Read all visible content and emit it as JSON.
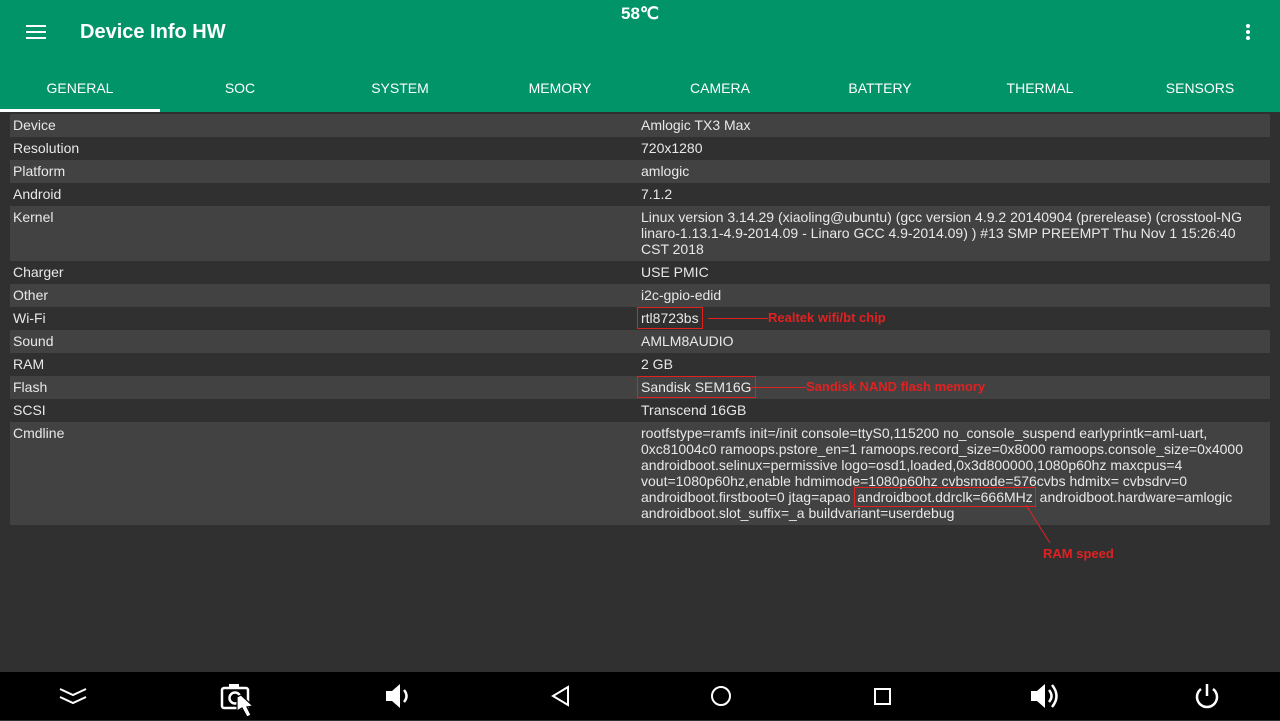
{
  "status": {
    "temperature": "58℃"
  },
  "app": {
    "title": "Device Info HW"
  },
  "tabs": [
    "GENERAL",
    "SOC",
    "SYSTEM",
    "MEMORY",
    "CAMERA",
    "BATTERY",
    "THERMAL",
    "SENSORS"
  ],
  "active_tab": "GENERAL",
  "rows": [
    {
      "key": "Device",
      "value": "Amlogic TX3 Max"
    },
    {
      "key": "Resolution",
      "value": "720x1280"
    },
    {
      "key": "Platform",
      "value": "amlogic"
    },
    {
      "key": "Android",
      "value": "7.1.2"
    },
    {
      "key": "Kernel",
      "value": "Linux version 3.14.29 (xiaoling@ubuntu) (gcc version 4.9.2 20140904 (prerelease) (crosstool-NG linaro-1.13.1-4.9-2014.09 - Linaro GCC 4.9-2014.09) ) #13 SMP PREEMPT Thu Nov 1 15:26:40 CST 2018"
    },
    {
      "key": "Charger",
      "value": "USE PMIC"
    },
    {
      "key": "Other",
      "value": "i2c-gpio-edid"
    },
    {
      "key": "Wi-Fi",
      "value": "rtl8723bs"
    },
    {
      "key": "Sound",
      "value": "AMLM8AUDIO"
    },
    {
      "key": "RAM",
      "value": "2 GB"
    },
    {
      "key": "Flash",
      "value": "Sandisk SEM16G"
    },
    {
      "key": "SCSI",
      "value": "Transcend 16GB"
    },
    {
      "key": "Cmdline",
      "value_before": "rootfstype=ramfs init=/init console=ttyS0,115200 no_console_suspend earlyprintk=aml-uart, 0xc81004c0 ramoops.pstore_en=1 ramoops.record_size=0x8000 ramoops.console_size=0x4000 androidboot.selinux=permissive logo=osd1,loaded,0x3d800000,1080p60hz maxcpus=4 vout=1080p60hz,enable hdmimode=1080p60hz cvbsmode=576cvbs hdmitx= cvbsdrv=0 androidboot.firstboot=0 jtag=apao",
      "value_highlight": "androidboot.ddrclk=666MHz",
      "value_after": "androidboot.hardware=amlogic androidboot.slot_suffix=_a buildvariant=userdebug"
    }
  ],
  "annotations": {
    "wifi": "Realtek wifi/bt chip",
    "flash": "Sandisk NAND flash memory",
    "ram": "RAM speed"
  },
  "colors": {
    "appbar": "#019468",
    "background": "#303030",
    "row_alt": "#424242",
    "annotation": "#e12121"
  },
  "navbar_icons": [
    "collapse-icon",
    "screenshot-icon",
    "volume-down-icon",
    "back-icon",
    "home-icon",
    "recents-icon",
    "volume-up-icon",
    "power-icon"
  ]
}
